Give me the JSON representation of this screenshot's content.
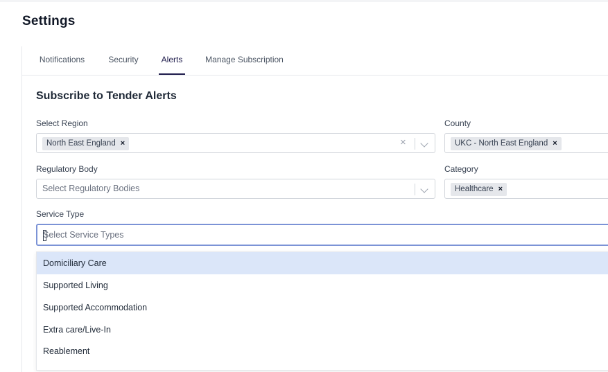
{
  "page": {
    "title": "Settings"
  },
  "tabs": [
    {
      "label": "Notifications"
    },
    {
      "label": "Security"
    },
    {
      "label": "Alerts",
      "active": true
    },
    {
      "label": "Manage Subscription"
    }
  ],
  "form": {
    "title": "Subscribe to Tender Alerts",
    "region": {
      "label": "Select Region",
      "selected": [
        "North East England"
      ]
    },
    "county": {
      "label": "County",
      "selected": [
        "UKC - North East England"
      ]
    },
    "regulatory": {
      "label": "Regulatory Body",
      "placeholder": "Select Regulatory Bodies"
    },
    "category": {
      "label": "Category",
      "selected": [
        "Healthcare"
      ]
    },
    "service": {
      "label": "Service Type",
      "placeholder": "Select Service Types"
    }
  },
  "dropdown": {
    "options": [
      "Domiciliary Care",
      "Supported Living",
      "Supported Accommodation",
      "Extra care/Live-In",
      "Reablement"
    ],
    "highlighted_index": 0
  },
  "colors": {
    "accent": "#1e1b4b",
    "highlight": "#dbe6f9",
    "focus": "#7c93d6"
  }
}
